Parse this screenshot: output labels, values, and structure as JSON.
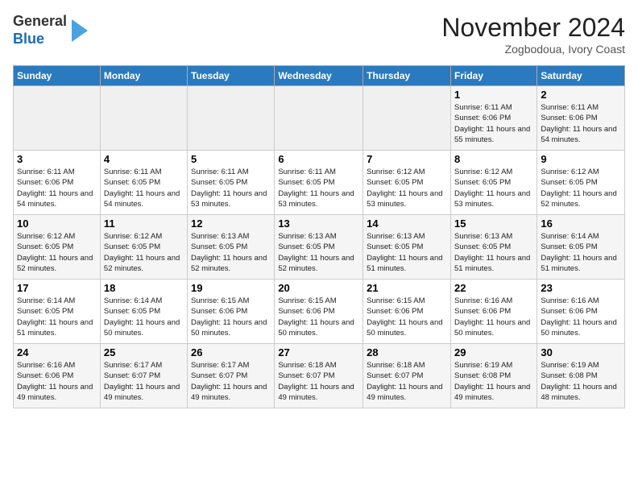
{
  "header": {
    "logo_general": "General",
    "logo_blue": "Blue",
    "month_year": "November 2024",
    "location": "Zogbodoua, Ivory Coast"
  },
  "days_of_week": [
    "Sunday",
    "Monday",
    "Tuesday",
    "Wednesday",
    "Thursday",
    "Friday",
    "Saturday"
  ],
  "weeks": [
    [
      {
        "day": "",
        "empty": true
      },
      {
        "day": "",
        "empty": true
      },
      {
        "day": "",
        "empty": true
      },
      {
        "day": "",
        "empty": true
      },
      {
        "day": "",
        "empty": true
      },
      {
        "day": "1",
        "sunrise": "6:11 AM",
        "sunset": "6:06 PM",
        "daylight": "11 hours and 55 minutes."
      },
      {
        "day": "2",
        "sunrise": "6:11 AM",
        "sunset": "6:06 PM",
        "daylight": "11 hours and 54 minutes."
      }
    ],
    [
      {
        "day": "3",
        "sunrise": "6:11 AM",
        "sunset": "6:06 PM",
        "daylight": "11 hours and 54 minutes."
      },
      {
        "day": "4",
        "sunrise": "6:11 AM",
        "sunset": "6:05 PM",
        "daylight": "11 hours and 54 minutes."
      },
      {
        "day": "5",
        "sunrise": "6:11 AM",
        "sunset": "6:05 PM",
        "daylight": "11 hours and 53 minutes."
      },
      {
        "day": "6",
        "sunrise": "6:11 AM",
        "sunset": "6:05 PM",
        "daylight": "11 hours and 53 minutes."
      },
      {
        "day": "7",
        "sunrise": "6:12 AM",
        "sunset": "6:05 PM",
        "daylight": "11 hours and 53 minutes."
      },
      {
        "day": "8",
        "sunrise": "6:12 AM",
        "sunset": "6:05 PM",
        "daylight": "11 hours and 53 minutes."
      },
      {
        "day": "9",
        "sunrise": "6:12 AM",
        "sunset": "6:05 PM",
        "daylight": "11 hours and 52 minutes."
      }
    ],
    [
      {
        "day": "10",
        "sunrise": "6:12 AM",
        "sunset": "6:05 PM",
        "daylight": "11 hours and 52 minutes."
      },
      {
        "day": "11",
        "sunrise": "6:12 AM",
        "sunset": "6:05 PM",
        "daylight": "11 hours and 52 minutes."
      },
      {
        "day": "12",
        "sunrise": "6:13 AM",
        "sunset": "6:05 PM",
        "daylight": "11 hours and 52 minutes."
      },
      {
        "day": "13",
        "sunrise": "6:13 AM",
        "sunset": "6:05 PM",
        "daylight": "11 hours and 52 minutes."
      },
      {
        "day": "14",
        "sunrise": "6:13 AM",
        "sunset": "6:05 PM",
        "daylight": "11 hours and 51 minutes."
      },
      {
        "day": "15",
        "sunrise": "6:13 AM",
        "sunset": "6:05 PM",
        "daylight": "11 hours and 51 minutes."
      },
      {
        "day": "16",
        "sunrise": "6:14 AM",
        "sunset": "6:05 PM",
        "daylight": "11 hours and 51 minutes."
      }
    ],
    [
      {
        "day": "17",
        "sunrise": "6:14 AM",
        "sunset": "6:05 PM",
        "daylight": "11 hours and 51 minutes."
      },
      {
        "day": "18",
        "sunrise": "6:14 AM",
        "sunset": "6:05 PM",
        "daylight": "11 hours and 50 minutes."
      },
      {
        "day": "19",
        "sunrise": "6:15 AM",
        "sunset": "6:06 PM",
        "daylight": "11 hours and 50 minutes."
      },
      {
        "day": "20",
        "sunrise": "6:15 AM",
        "sunset": "6:06 PM",
        "daylight": "11 hours and 50 minutes."
      },
      {
        "day": "21",
        "sunrise": "6:15 AM",
        "sunset": "6:06 PM",
        "daylight": "11 hours and 50 minutes."
      },
      {
        "day": "22",
        "sunrise": "6:16 AM",
        "sunset": "6:06 PM",
        "daylight": "11 hours and 50 minutes."
      },
      {
        "day": "23",
        "sunrise": "6:16 AM",
        "sunset": "6:06 PM",
        "daylight": "11 hours and 50 minutes."
      }
    ],
    [
      {
        "day": "24",
        "sunrise": "6:16 AM",
        "sunset": "6:06 PM",
        "daylight": "11 hours and 49 minutes."
      },
      {
        "day": "25",
        "sunrise": "6:17 AM",
        "sunset": "6:07 PM",
        "daylight": "11 hours and 49 minutes."
      },
      {
        "day": "26",
        "sunrise": "6:17 AM",
        "sunset": "6:07 PM",
        "daylight": "11 hours and 49 minutes."
      },
      {
        "day": "27",
        "sunrise": "6:18 AM",
        "sunset": "6:07 PM",
        "daylight": "11 hours and 49 minutes."
      },
      {
        "day": "28",
        "sunrise": "6:18 AM",
        "sunset": "6:07 PM",
        "daylight": "11 hours and 49 minutes."
      },
      {
        "day": "29",
        "sunrise": "6:19 AM",
        "sunset": "6:08 PM",
        "daylight": "11 hours and 49 minutes."
      },
      {
        "day": "30",
        "sunrise": "6:19 AM",
        "sunset": "6:08 PM",
        "daylight": "11 hours and 48 minutes."
      }
    ]
  ]
}
